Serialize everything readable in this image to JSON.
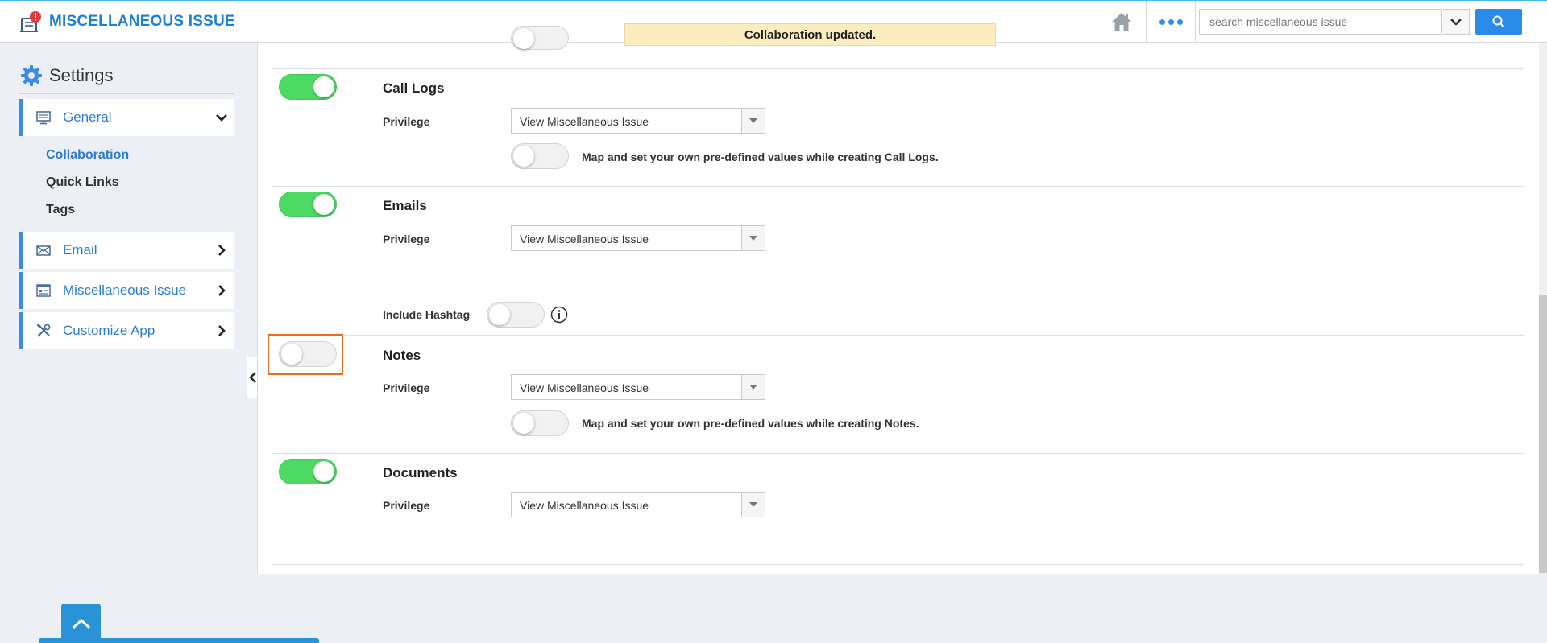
{
  "header": {
    "app_title": "MISCELLANEOUS ISSUE",
    "search_placeholder": "search miscellaneous issue",
    "toast": "Collaboration updated."
  },
  "sidebar": {
    "title": "Settings",
    "items": [
      {
        "label": "General",
        "expanded": true
      },
      {
        "label": "Email",
        "expanded": false
      },
      {
        "label": "Miscellaneous Issue",
        "expanded": false
      },
      {
        "label": "Customize App",
        "expanded": false
      }
    ],
    "sub_items": [
      {
        "label": "Collaboration",
        "active": true
      },
      {
        "label": "Quick Links",
        "active": false
      },
      {
        "label": "Tags",
        "active": false
      }
    ]
  },
  "sections": [
    {
      "title": "Call Logs",
      "enabled": true,
      "privilege_label": "Privilege",
      "privilege_value": "View Miscellaneous Issue",
      "helper_enabled": false,
      "helper": "Map and set your own pre-defined values while creating Call Logs."
    },
    {
      "title": "Emails",
      "enabled": true,
      "privilege_label": "Privilege",
      "privilege_value": "View Miscellaneous Issue",
      "hashtag_label": "Include Hashtag",
      "hashtag_enabled": false
    },
    {
      "title": "Notes",
      "enabled": false,
      "privilege_label": "Privilege",
      "privilege_value": "View Miscellaneous Issue",
      "helper_enabled": false,
      "helper": "Map and set your own pre-defined values while creating Notes."
    },
    {
      "title": "Documents",
      "enabled": true,
      "privilege_label": "Privilege",
      "privilege_value": "View Miscellaneous Issue"
    }
  ],
  "colors": {
    "accent": "#2a8ce8",
    "toggle_on": "#4cd964",
    "highlight": "#f06a1a",
    "toast_bg": "#fbedc0"
  }
}
